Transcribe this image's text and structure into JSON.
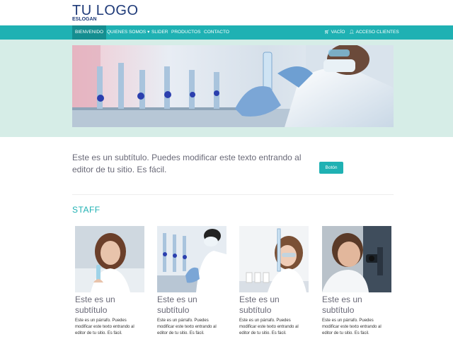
{
  "header": {
    "logo": "TU LOGO",
    "slogan": "ESLOGAN"
  },
  "nav": {
    "items": [
      {
        "label": "BIENVENIDO",
        "active": true
      },
      {
        "label": "QUIENES SOMOS ▾",
        "active": false
      },
      {
        "label": "SLIDER",
        "active": false
      },
      {
        "label": "PRODUCTOS",
        "active": false
      },
      {
        "label": "CONTACTO",
        "active": false
      }
    ],
    "cart": "VACÍO",
    "clients": "ACCESO CLIENTES",
    "cart_icon": "cart-icon",
    "user_icon": "user-icon"
  },
  "hero": {
    "image": "laboratory-banner"
  },
  "intro": {
    "subtitle": "Este es un subtítulo. Puedes modificar este texto entrando al editor de tu sitio. Es fácil.",
    "button": "Botón"
  },
  "staff": {
    "title": "STAFF",
    "cards": [
      {
        "title": "Este es un subtítulo",
        "text": "Este es un párrafo. Puedes modificar este texto entrando al editor de tu sitio. Es fácil."
      },
      {
        "title": "Este es un subtítulo",
        "text": "Este es un párrafo. Puedes modificar este texto entrando al editor de tu sitio. Es fácil."
      },
      {
        "title": "Este es un subtítulo",
        "text": "Este es un párrafo. Puedes modificar este texto entrando al editor de tu sitio. Es fácil."
      },
      {
        "title": "Este es un subtítulo",
        "text": "Este es un párrafo. Puedes modificar este texto entrando al editor de tu sitio. Es fácil."
      }
    ]
  },
  "colors": {
    "accent": "#1fb1b3",
    "logo": "#1e3a78",
    "hero_band": "#d6ede7"
  }
}
